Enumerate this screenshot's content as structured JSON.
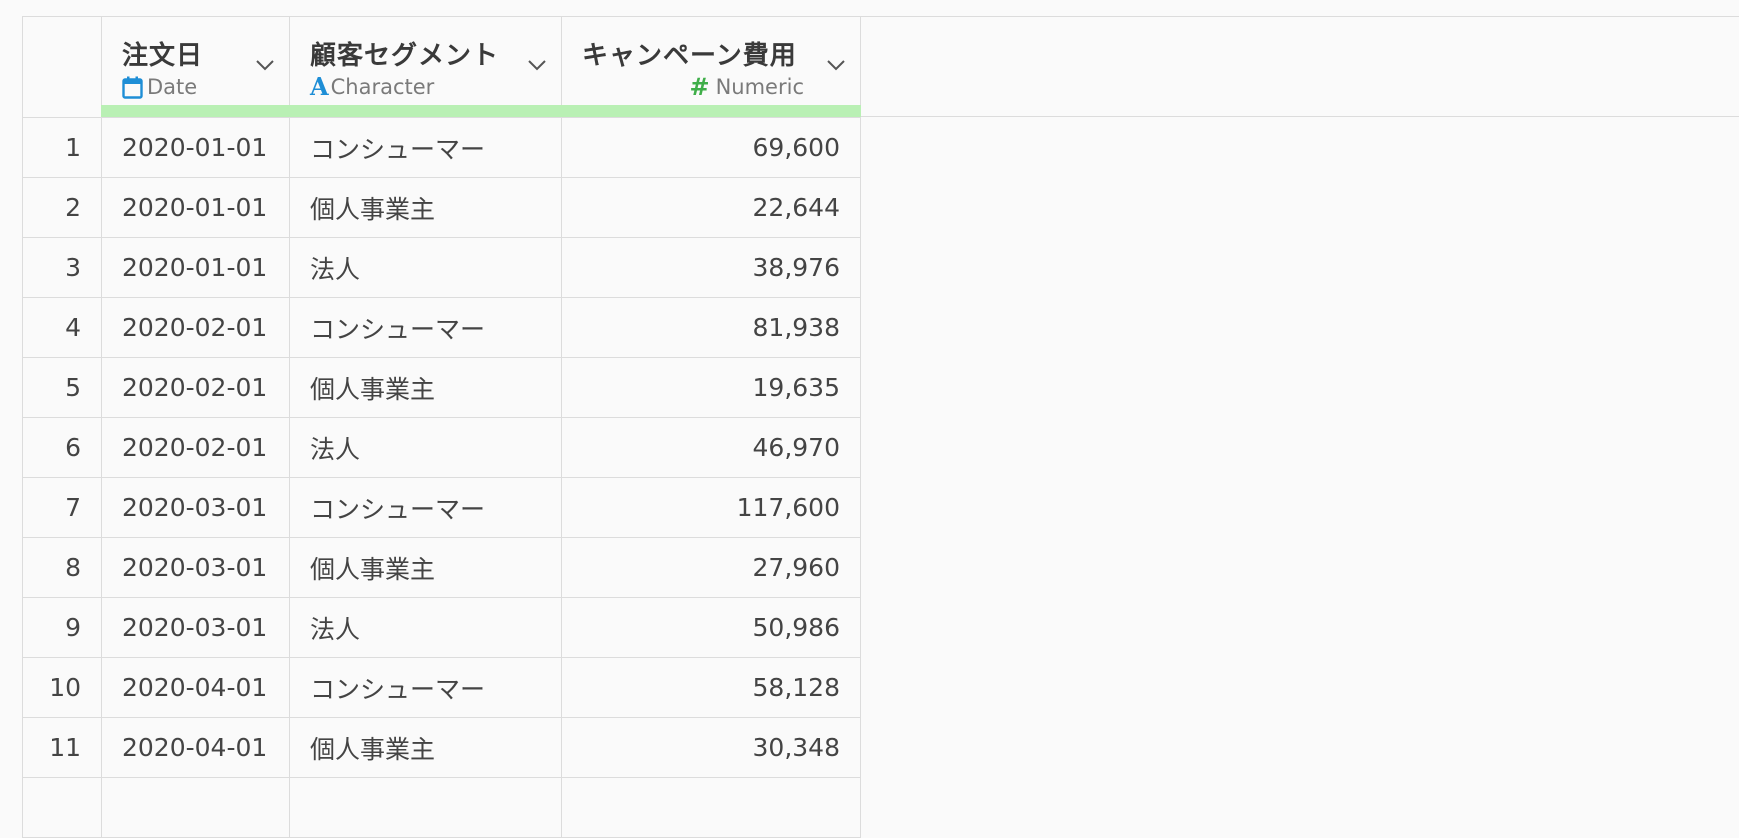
{
  "columns": [
    {
      "name": "注文日",
      "type": "Date",
      "type_icon": "calendar-icon"
    },
    {
      "name": "顧客セグメント",
      "type": "Character",
      "type_icon": "character-type-icon"
    },
    {
      "name": "キャンペーン費用",
      "type": "Numeric",
      "type_icon": "numeric-hash-icon"
    }
  ],
  "rows": [
    {
      "n": "1",
      "date": "2020-01-01",
      "segment": "コンシューマー",
      "cost": "69,600"
    },
    {
      "n": "2",
      "date": "2020-01-01",
      "segment": "個人事業主",
      "cost": "22,644"
    },
    {
      "n": "3",
      "date": "2020-01-01",
      "segment": "法人",
      "cost": "38,976"
    },
    {
      "n": "4",
      "date": "2020-02-01",
      "segment": "コンシューマー",
      "cost": "81,938"
    },
    {
      "n": "5",
      "date": "2020-02-01",
      "segment": "個人事業主",
      "cost": "19,635"
    },
    {
      "n": "6",
      "date": "2020-02-01",
      "segment": "法人",
      "cost": "46,970"
    },
    {
      "n": "7",
      "date": "2020-03-01",
      "segment": "コンシューマー",
      "cost": "117,600"
    },
    {
      "n": "8",
      "date": "2020-03-01",
      "segment": "個人事業主",
      "cost": "27,960"
    },
    {
      "n": "9",
      "date": "2020-03-01",
      "segment": "法人",
      "cost": "50,986"
    },
    {
      "n": "10",
      "date": "2020-04-01",
      "segment": "コンシューマー",
      "cost": "58,128"
    },
    {
      "n": "11",
      "date": "2020-04-01",
      "segment": "個人事業主",
      "cost": "30,348"
    },
    {
      "n": "",
      "date": "",
      "segment": "",
      "cost": ""
    }
  ],
  "colors": {
    "quality_bar": "#b9f0b4",
    "date_icon": "#1e8ed6",
    "character_icon": "#1e8ed6",
    "numeric_icon": "#3fae49",
    "grid_border": "#dcdcdc"
  }
}
